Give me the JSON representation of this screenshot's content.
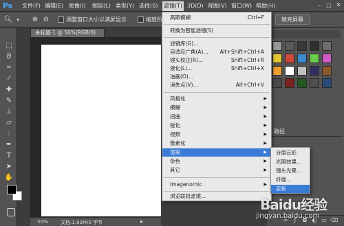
{
  "app": {
    "logo_text": "Ps"
  },
  "menubar": {
    "items": [
      {
        "label": "文件(F)"
      },
      {
        "label": "编辑(E)"
      },
      {
        "label": "图像(I)"
      },
      {
        "label": "图层(L)"
      },
      {
        "label": "类型(Y)"
      },
      {
        "label": "选择(S)"
      },
      {
        "label": "滤镜(T)"
      },
      {
        "label": "3D(D)"
      },
      {
        "label": "视图(V)"
      },
      {
        "label": "窗口(W)"
      },
      {
        "label": "帮助(H)"
      }
    ],
    "active": "滤镜(T)"
  },
  "options_bar": {
    "zoom_tool_icon": "zoom-icon",
    "checkbox1_label": "调整窗口大小以满屏显示",
    "checkbox2_label": "缩放所有窗口",
    "fill_screen_label": "填充屏幕"
  },
  "document": {
    "tab_title": "未标题-1 @ 50%(RGB/8)",
    "zoom": "50%",
    "doc_info": "文档:1.83M/0 字节"
  },
  "filter_menu": {
    "items": [
      {
        "label": "高斯模糊",
        "shortcut": "Ctrl+F"
      },
      {
        "label": "转换为智能滤镜(S)"
      },
      {
        "label": "滤镜库(G)..."
      },
      {
        "label": "自适应广角(A)...",
        "shortcut": "Alt+Shift+Ctrl+A"
      },
      {
        "label": "镜头校正(R)...",
        "shortcut": "Shift+Ctrl+R"
      },
      {
        "label": "液化(L)...",
        "shortcut": "Shift+Ctrl+X"
      },
      {
        "label": "油画(O)..."
      },
      {
        "label": "消失点(V)...",
        "shortcut": "Alt+Ctrl+V"
      },
      {
        "label": "风格化",
        "submenu": true
      },
      {
        "label": "模糊",
        "submenu": true
      },
      {
        "label": "扭曲",
        "submenu": true
      },
      {
        "label": "锐化",
        "submenu": true
      },
      {
        "label": "视频",
        "submenu": true
      },
      {
        "label": "像素化",
        "submenu": true
      },
      {
        "label": "渲染",
        "submenu": true,
        "highlighted": true
      },
      {
        "label": "杂色",
        "submenu": true
      },
      {
        "label": "其它",
        "submenu": true
      },
      {
        "label": "Imagenomic",
        "submenu": true
      },
      {
        "label": "浏览联机滤镜..."
      }
    ]
  },
  "render_submenu": {
    "items": [
      {
        "label": "分层云彩"
      },
      {
        "label": "光照效果..."
      },
      {
        "label": "镜头光晕..."
      },
      {
        "label": "纤维..."
      },
      {
        "label": "云彩",
        "highlighted": true
      }
    ]
  },
  "panels": {
    "paths_tab": "路径"
  },
  "colors": {
    "highlight": "#3a7bd5",
    "foreground": "#000000",
    "background": "#ffffff"
  },
  "watermark": {
    "logo": "Baidu经验",
    "url": "jingyan.baidu.com"
  }
}
